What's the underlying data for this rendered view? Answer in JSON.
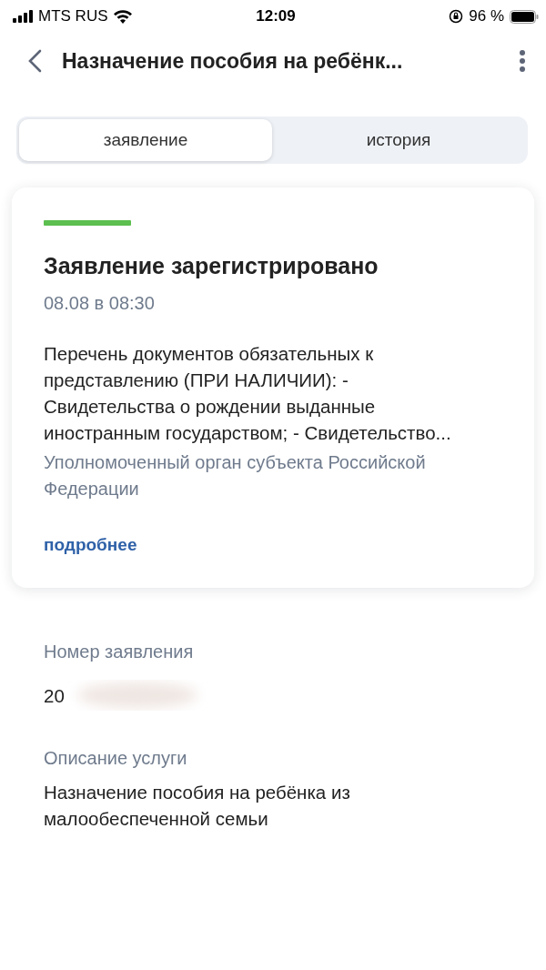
{
  "status_bar": {
    "carrier": "MTS RUS",
    "time": "12:09",
    "battery": "96 %"
  },
  "header": {
    "title": "Назначение пособия на ребёнк..."
  },
  "tabs": [
    {
      "label": "заявление",
      "selected": true
    },
    {
      "label": "история",
      "selected": false
    }
  ],
  "status_card": {
    "color": "#5cbf4f",
    "title": "Заявление зарегистрировано",
    "date": "08.08 в 08:30",
    "description": "Перечень документов обязательных к представлению (ПРИ НАЛИЧИИ): - Свидетельства о рождении выданные иностранным государством; - Свидетельство...",
    "authority": "Уполномоченный орган субъекта Российской Федерации",
    "link": "подробнее"
  },
  "details": [
    {
      "label": "Номер заявления",
      "value": "20",
      "redacted": true
    },
    {
      "label": "Описание услуги",
      "value": "Назначение пособия на ребёнка из малообеспеченной семьи",
      "redacted": false
    }
  ]
}
